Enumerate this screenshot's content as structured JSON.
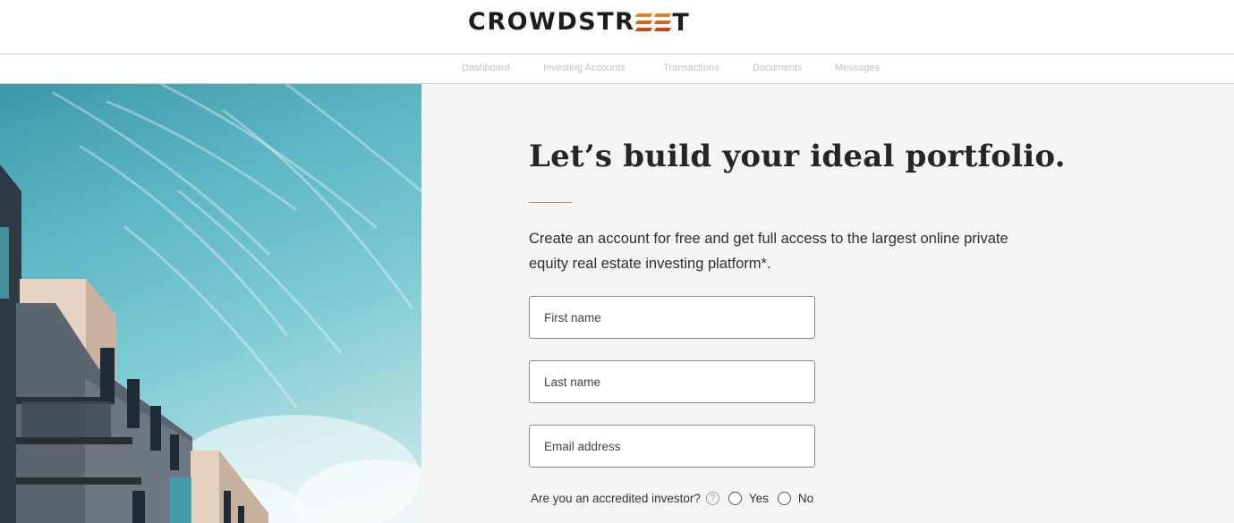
{
  "header": {
    "logo_prefix": "CROWDSTR",
    "logo_suffix": "T"
  },
  "nav": {
    "items": [
      {
        "label": "Dashboard"
      },
      {
        "label": "Investing Accounts"
      },
      {
        "label": "Transactions"
      },
      {
        "label": "Documents"
      },
      {
        "label": "Messages"
      }
    ]
  },
  "signup": {
    "headline": "Let’s build your ideal portfolio.",
    "intro": "Create an account for free and get full access to the largest online private equity real estate investing platform*.",
    "first_name_placeholder": "First name",
    "last_name_placeholder": "Last name",
    "email_placeholder": "Email address",
    "accredited_question": "Are you an accredited investor?",
    "help_glyph": "?",
    "yes_label": "Yes",
    "no_label": "No"
  },
  "colors": {
    "accent_gold": "#b9935a",
    "logo_orange": "#d8560f",
    "panel_bg": "#f4f4f4"
  }
}
